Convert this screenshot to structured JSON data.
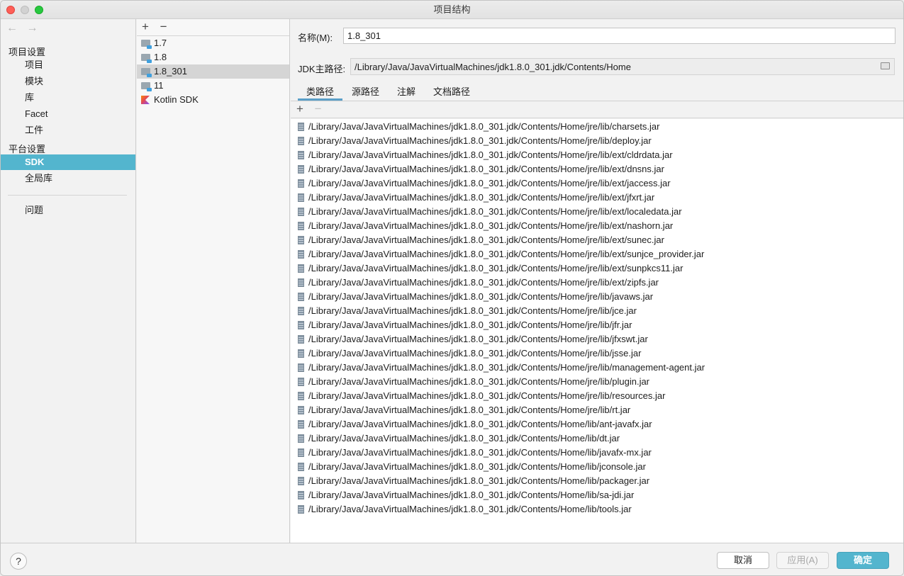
{
  "window": {
    "title": "项目结构"
  },
  "nav": {
    "back_arrow": "←",
    "forward_arrow": "→",
    "project_settings_header": "项目设置",
    "project_items": [
      "项目",
      "模块",
      "库",
      "Facet",
      "工件"
    ],
    "platform_settings_header": "平台设置",
    "platform_items": [
      "SDK",
      "全局库"
    ],
    "selected": "SDK",
    "problems": "问题"
  },
  "sdk_list": {
    "add": "+",
    "remove": "−",
    "items": [
      {
        "label": "1.7",
        "icon": "jdk-folder-icon"
      },
      {
        "label": "1.8",
        "icon": "jdk-folder-icon"
      },
      {
        "label": "1.8_301",
        "icon": "jdk-folder-icon"
      },
      {
        "label": "11",
        "icon": "jdk-folder-icon"
      },
      {
        "label": "Kotlin SDK",
        "icon": "kotlin-icon"
      }
    ],
    "selected": "1.8_301"
  },
  "detail": {
    "name_label": "名称(M):",
    "name_value": "1.8_301",
    "jdk_home_label": "JDK主路径:",
    "jdk_home_value": "/Library/Java/JavaVirtualMachines/jdk1.8.0_301.jdk/Contents/Home",
    "tabs": [
      "类路径",
      "源路径",
      "注解",
      "文档路径"
    ],
    "active_tab": "类路径",
    "add": "+",
    "remove": "−",
    "classpath": [
      "/Library/Java/JavaVirtualMachines/jdk1.8.0_301.jdk/Contents/Home/jre/lib/charsets.jar",
      "/Library/Java/JavaVirtualMachines/jdk1.8.0_301.jdk/Contents/Home/jre/lib/deploy.jar",
      "/Library/Java/JavaVirtualMachines/jdk1.8.0_301.jdk/Contents/Home/jre/lib/ext/cldrdata.jar",
      "/Library/Java/JavaVirtualMachines/jdk1.8.0_301.jdk/Contents/Home/jre/lib/ext/dnsns.jar",
      "/Library/Java/JavaVirtualMachines/jdk1.8.0_301.jdk/Contents/Home/jre/lib/ext/jaccess.jar",
      "/Library/Java/JavaVirtualMachines/jdk1.8.0_301.jdk/Contents/Home/jre/lib/ext/jfxrt.jar",
      "/Library/Java/JavaVirtualMachines/jdk1.8.0_301.jdk/Contents/Home/jre/lib/ext/localedata.jar",
      "/Library/Java/JavaVirtualMachines/jdk1.8.0_301.jdk/Contents/Home/jre/lib/ext/nashorn.jar",
      "/Library/Java/JavaVirtualMachines/jdk1.8.0_301.jdk/Contents/Home/jre/lib/ext/sunec.jar",
      "/Library/Java/JavaVirtualMachines/jdk1.8.0_301.jdk/Contents/Home/jre/lib/ext/sunjce_provider.jar",
      "/Library/Java/JavaVirtualMachines/jdk1.8.0_301.jdk/Contents/Home/jre/lib/ext/sunpkcs11.jar",
      "/Library/Java/JavaVirtualMachines/jdk1.8.0_301.jdk/Contents/Home/jre/lib/ext/zipfs.jar",
      "/Library/Java/JavaVirtualMachines/jdk1.8.0_301.jdk/Contents/Home/jre/lib/javaws.jar",
      "/Library/Java/JavaVirtualMachines/jdk1.8.0_301.jdk/Contents/Home/jre/lib/jce.jar",
      "/Library/Java/JavaVirtualMachines/jdk1.8.0_301.jdk/Contents/Home/jre/lib/jfr.jar",
      "/Library/Java/JavaVirtualMachines/jdk1.8.0_301.jdk/Contents/Home/jre/lib/jfxswt.jar",
      "/Library/Java/JavaVirtualMachines/jdk1.8.0_301.jdk/Contents/Home/jre/lib/jsse.jar",
      "/Library/Java/JavaVirtualMachines/jdk1.8.0_301.jdk/Contents/Home/jre/lib/management-agent.jar",
      "/Library/Java/JavaVirtualMachines/jdk1.8.0_301.jdk/Contents/Home/jre/lib/plugin.jar",
      "/Library/Java/JavaVirtualMachines/jdk1.8.0_301.jdk/Contents/Home/jre/lib/resources.jar",
      "/Library/Java/JavaVirtualMachines/jdk1.8.0_301.jdk/Contents/Home/jre/lib/rt.jar",
      "/Library/Java/JavaVirtualMachines/jdk1.8.0_301.jdk/Contents/Home/lib/ant-javafx.jar",
      "/Library/Java/JavaVirtualMachines/jdk1.8.0_301.jdk/Contents/Home/lib/dt.jar",
      "/Library/Java/JavaVirtualMachines/jdk1.8.0_301.jdk/Contents/Home/lib/javafx-mx.jar",
      "/Library/Java/JavaVirtualMachines/jdk1.8.0_301.jdk/Contents/Home/lib/jconsole.jar",
      "/Library/Java/JavaVirtualMachines/jdk1.8.0_301.jdk/Contents/Home/lib/packager.jar",
      "/Library/Java/JavaVirtualMachines/jdk1.8.0_301.jdk/Contents/Home/lib/sa-jdi.jar",
      "/Library/Java/JavaVirtualMachines/jdk1.8.0_301.jdk/Contents/Home/lib/tools.jar"
    ]
  },
  "footer": {
    "help": "?",
    "cancel": "取消",
    "apply": "应用(A)",
    "ok": "确定"
  },
  "colors": {
    "accent": "#53b5ce",
    "tab_underline": "#5a9fc8"
  }
}
